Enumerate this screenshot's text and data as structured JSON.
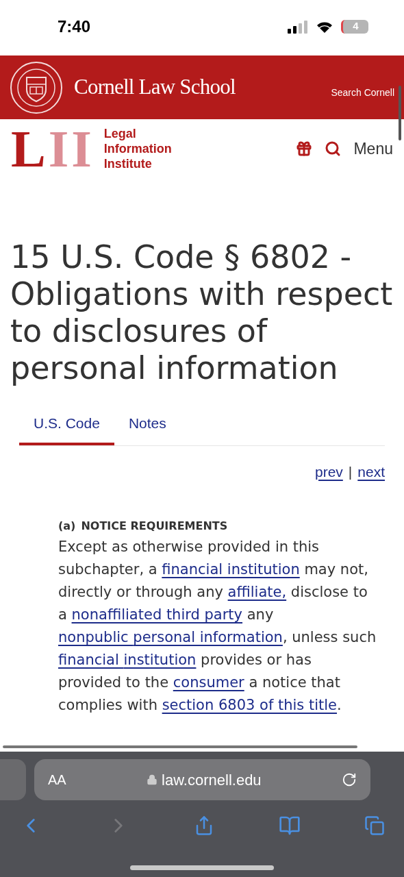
{
  "status_bar": {
    "time": "7:40",
    "battery": "4"
  },
  "banner": {
    "title": "Cornell Law School",
    "search_link": "Search Cornell"
  },
  "site_header": {
    "logo_letters": "LII",
    "logo_text": [
      "Legal",
      "Information",
      "Institute"
    ],
    "menu_label": "Menu"
  },
  "page_title": "15 U.S. Code § 6802 - Obligations with respect to disclosures of personal information",
  "tabs": [
    {
      "label": "U.S. Code",
      "selected": true
    },
    {
      "label": "Notes",
      "selected": false
    }
  ],
  "pager": {
    "prev": "prev",
    "separator": "|",
    "next": "next"
  },
  "section": {
    "label": "(a)",
    "heading": "NOTICE REQUIREMENTS",
    "body": [
      {
        "kind": "text",
        "text": "Except as otherwise provided in this subchapter, a "
      },
      {
        "kind": "link",
        "text": "financial institution"
      },
      {
        "kind": "text",
        "text": " may not, directly or through any "
      },
      {
        "kind": "link",
        "text": "affiliate,"
      },
      {
        "kind": "text",
        "text": " disclose to a "
      },
      {
        "kind": "link",
        "text": "nonaffiliated third party"
      },
      {
        "kind": "text",
        "text": " any "
      },
      {
        "kind": "link",
        "text": "nonpublic "
      },
      {
        "kind": "link",
        "text": "personal information"
      },
      {
        "kind": "text",
        "text": ", unless such "
      },
      {
        "kind": "link",
        "text": "financial "
      },
      {
        "kind": "link",
        "text": "institution"
      },
      {
        "kind": "text",
        "text": " provides or has provided to the "
      },
      {
        "kind": "link",
        "text": "consumer"
      },
      {
        "kind": "text",
        "text": " a notice that complies with "
      },
      {
        "kind": "link",
        "text": "section 6803 of this title"
      },
      {
        "kind": "text",
        "text": "."
      }
    ]
  },
  "browser": {
    "text_size_button": "AA",
    "url": "law.cornell.edu"
  }
}
